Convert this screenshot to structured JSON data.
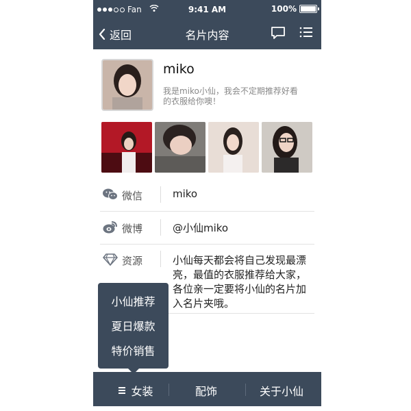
{
  "statusbar": {
    "carrier": "Fan",
    "time": "9:41 AM",
    "battery": "100%"
  },
  "navbar": {
    "back_label": "返回",
    "title": "名片内容"
  },
  "profile": {
    "name": "miko",
    "bio": "我是miko小仙，我会不定期推荐好看的衣服给你噢！"
  },
  "info": {
    "wechat": {
      "label": "微信",
      "value": "miko"
    },
    "weibo": {
      "label": "微博",
      "value": "@小仙miko"
    },
    "source": {
      "label": "资源",
      "value": "小仙每天都会将自己发现最漂亮，最值的衣服推荐给大家，各位亲一定要将小仙的名片加入名片夹哦。"
    }
  },
  "popup_menu": {
    "items": [
      "小仙推荐",
      "夏日爆款",
      "特价销售"
    ]
  },
  "bottom_tabs": {
    "women_clothing": "女装",
    "accessories": "配饰",
    "about": "关于小仙"
  },
  "colors": {
    "nav_bg": "#3c4a5b",
    "text_dark": "#222222",
    "text_muted": "#888888"
  }
}
